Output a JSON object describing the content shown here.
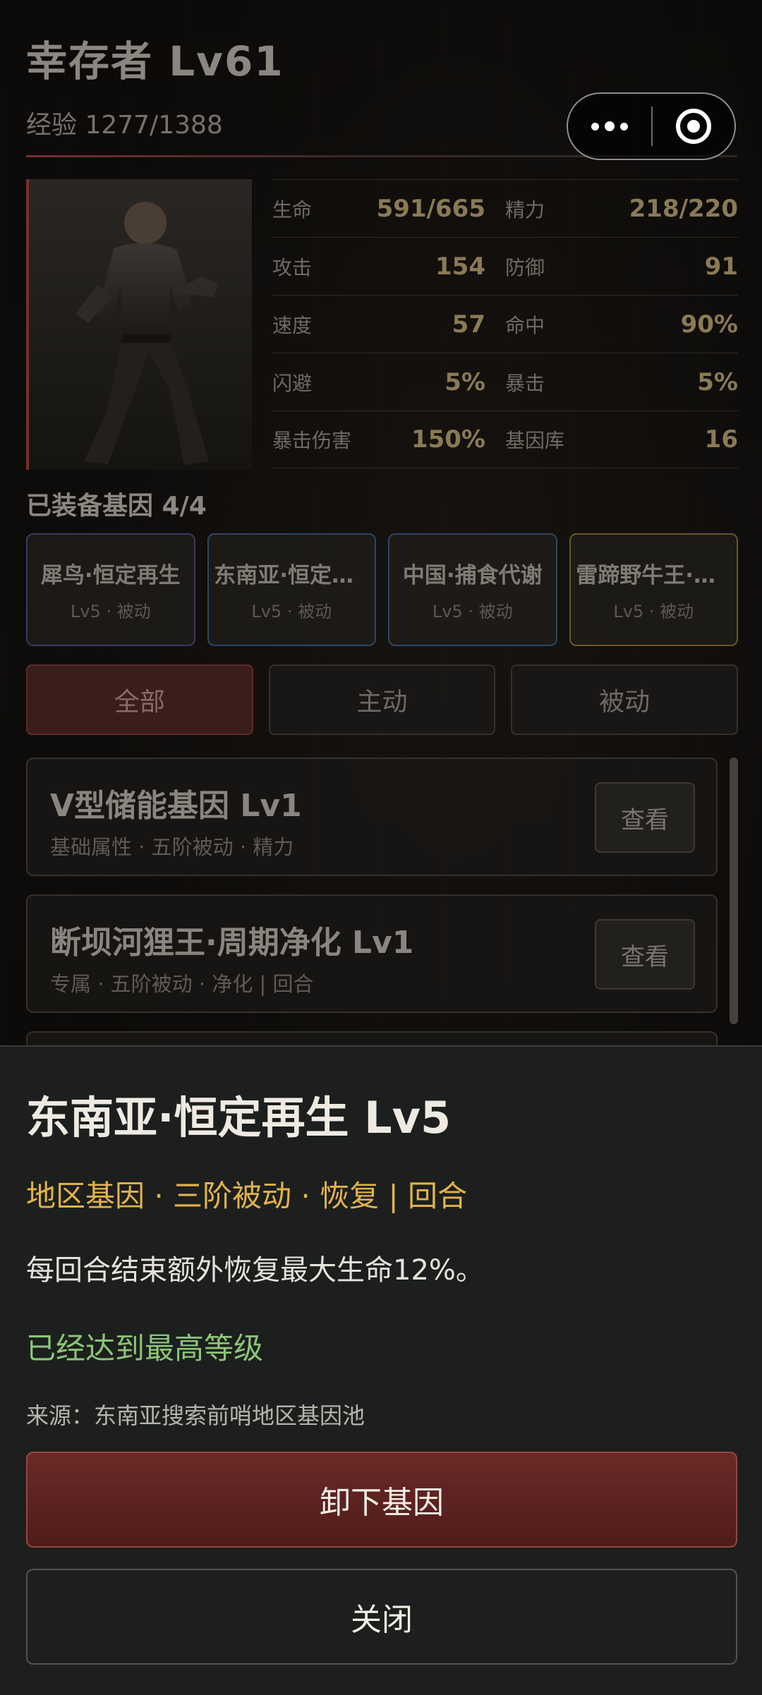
{
  "header": {
    "title": "幸存者 Lv61",
    "exp": "经验 1277/1388"
  },
  "capsule": {
    "more_icon": "more-dots-icon",
    "close_icon": "target-close-icon"
  },
  "portrait": {
    "icon": "survivor-portrait"
  },
  "stats": [
    [
      {
        "label": "生命",
        "value": "591/665"
      },
      {
        "label": "精力",
        "value": "218/220"
      }
    ],
    [
      {
        "label": "攻击",
        "value": "154"
      },
      {
        "label": "防御",
        "value": "91"
      }
    ],
    [
      {
        "label": "速度",
        "value": "57"
      },
      {
        "label": "命中",
        "value": "90%"
      }
    ],
    [
      {
        "label": "闪避",
        "value": "5%"
      },
      {
        "label": "暴击",
        "value": "5%"
      }
    ],
    [
      {
        "label": "暴击伤害",
        "value": "150%"
      },
      {
        "label": "基因库",
        "value": "16"
      }
    ]
  ],
  "equipped": {
    "title": "已装备基因 4/4",
    "genes": [
      {
        "name": "犀鸟·恒定再生",
        "sub": "Lv5 · 被动"
      },
      {
        "name": "东南亚·恒定再生",
        "sub": "Lv5 · 被动"
      },
      {
        "name": "中国·捕食代谢",
        "sub": "Lv5 · 被动"
      },
      {
        "name": "雷蹄野牛王·狂暴",
        "sub": "Lv5 · 被动"
      }
    ]
  },
  "filters": [
    "全部",
    "主动",
    "被动"
  ],
  "list": [
    {
      "name": "V型储能基因 Lv1",
      "meta": "基础属性 · 五阶被动 · 精力",
      "button": "查看"
    },
    {
      "name": "断坝河狸王·周期净化 Lv1",
      "meta": "专属 · 五阶被动 · 净化 | 回合",
      "button": "查看"
    }
  ],
  "sheet": {
    "title": "东南亚·恒定再生 Lv5",
    "tags": "地区基因 · 三阶被动 · 恢复 | 回合",
    "description": "每回合结束额外恢复最大生命12%。",
    "max_level": "已经达到最高等级",
    "source": "来源：东南亚搜索前哨地区基因池",
    "unequip_label": "卸下基因",
    "close_label": "关闭"
  },
  "colors": {
    "accent_red": "#7a2f2a",
    "tag_gold": "#e2b24c",
    "max_green": "#8cc478"
  }
}
